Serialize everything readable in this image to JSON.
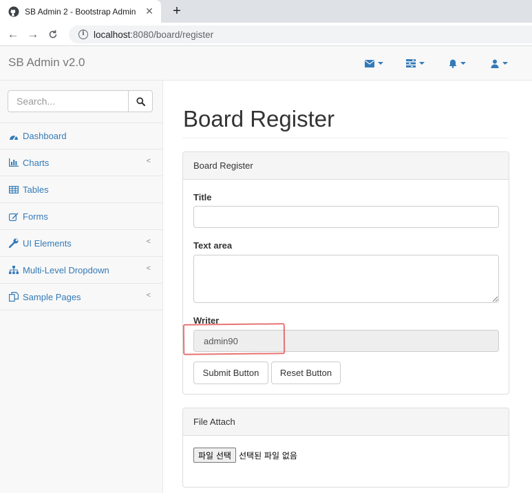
{
  "browser": {
    "tab_title": "SB Admin 2 - Bootstrap Admin",
    "url_host": "localhost",
    "url_path": ":8080/board/register"
  },
  "navbar": {
    "brand": "SB Admin v2.0",
    "icons": [
      "envelope-icon",
      "tasks-icon",
      "bell-icon",
      "user-icon"
    ],
    "accent_color": "#337ab7"
  },
  "sidebar": {
    "search_placeholder": "Search...",
    "items": [
      {
        "label": "Dashboard",
        "icon": "dashboard-icon",
        "has_arrow": false
      },
      {
        "label": "Charts",
        "icon": "bar-chart-icon",
        "has_arrow": true
      },
      {
        "label": "Tables",
        "icon": "table-icon",
        "has_arrow": false
      },
      {
        "label": "Forms",
        "icon": "edit-icon",
        "has_arrow": false
      },
      {
        "label": "UI Elements",
        "icon": "wrench-icon",
        "has_arrow": true
      },
      {
        "label": "Multi-Level Dropdown",
        "icon": "sitemap-icon",
        "has_arrow": true
      },
      {
        "label": "Sample Pages",
        "icon": "files-icon",
        "has_arrow": true
      }
    ]
  },
  "main": {
    "page_title": "Board Register",
    "register_panel": {
      "heading": "Board Register",
      "title_label": "Title",
      "title_value": "",
      "textarea_label": "Text area",
      "textarea_value": "",
      "writer_label": "Writer",
      "writer_value": "admin90",
      "submit_label": "Submit Button",
      "reset_label": "Reset Button"
    },
    "file_panel": {
      "heading": "File Attach",
      "choose_label": "파일 선택",
      "status": "선택된 파일 없음"
    }
  },
  "annotation_color": "#e05050"
}
